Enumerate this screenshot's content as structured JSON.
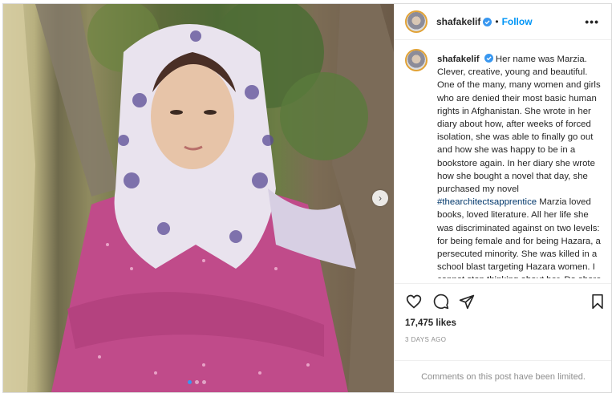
{
  "post": {
    "username": "shafakelif",
    "follow_label": "Follow",
    "separator": "•",
    "more_label": "•••",
    "caption_prefix": "Her name was Marzia. Clever, creative, young and beautiful. One of the many, many women and girls who are denied their most basic human rights in Afghanistan. She wrote in her diary about how, after weeks of forced isolation, she was able to finally go out and how she was happy to be in a bookstore again. In her diary she wrote how she bought a novel that day, she purchased my novel ",
    "hashtag": "#thearchitectsapprentice",
    "caption_suffix": " Marzia loved books, loved literature. All her life she was discriminated against on two levels: for being female and for being Hazara, a persecuted minority. She was killed in a school blast targeting Hazara women. I cannot stop thinking about her. Do share her",
    "likes": "17,475 likes",
    "time": "3 DAYS AGO",
    "comments_limited": "Comments on this post have been limited.",
    "carousel": {
      "total": 3,
      "active": 0
    }
  },
  "icons": {
    "verified": "verified-badge-icon",
    "like": "heart-icon",
    "comment": "comment-icon",
    "share": "share-icon",
    "save": "bookmark-icon",
    "next": "chevron-right-icon"
  },
  "colors": {
    "link": "#0095f6",
    "hashtag": "#00376b",
    "muted": "#8e8e8e"
  }
}
